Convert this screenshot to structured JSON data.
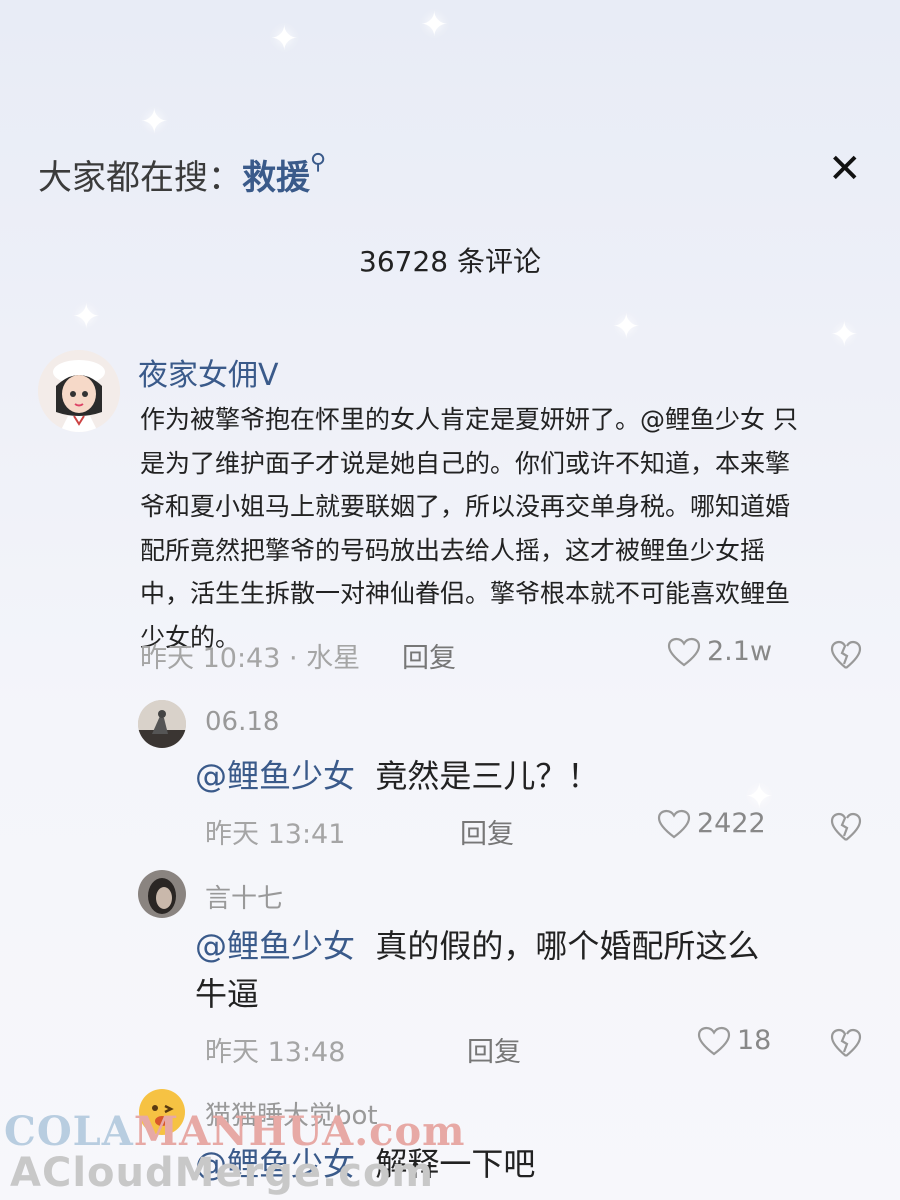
{
  "search": {
    "label": "大家都在搜：",
    "keyword": "救援"
  },
  "comments_count": "36728 条评论",
  "main_comment": {
    "username": "夜家女佣V",
    "text": "作为被擎爷抱在怀里的女人肯定是夏妍妍了。@鲤鱼少女 只是为了维护面子才说是她自己的。你们或许不知道，本来擎爷和夏小姐马上就要联姻了，所以没再交单身税。哪知道婚配所竟然把擎爷的号码放出去给人摇，这才被鲤鱼少女摇中，活生生拆散一对神仙眷侣。擎爷根本就不可能喜欢鲤鱼少女的。",
    "meta": "昨天 10:43 · 水星",
    "reply_label": "回复",
    "likes": "2.1w"
  },
  "replies": [
    {
      "username": "06.18",
      "mention": "@鲤鱼少女",
      "text": "竟然是三儿？！",
      "meta": "昨天 13:41",
      "reply_label": "回复",
      "likes": "2422"
    },
    {
      "username": "言十七",
      "mention": "@鲤鱼少女",
      "text": "真的假的，哪个婚配所这么牛逼",
      "meta": "昨天 13:48",
      "reply_label": "回复",
      "likes": "18"
    },
    {
      "username": "猫猫睡大觉bot",
      "mention": "@鲤鱼少女",
      "text": "解释一下吧"
    }
  ],
  "watermark": {
    "line1_a": "COLA",
    "line1_b": "MANHUA.com",
    "line2": "ACloudMerge.com"
  },
  "colors": {
    "accent": "#3a5a8a",
    "muted": "#a5a5a5"
  }
}
